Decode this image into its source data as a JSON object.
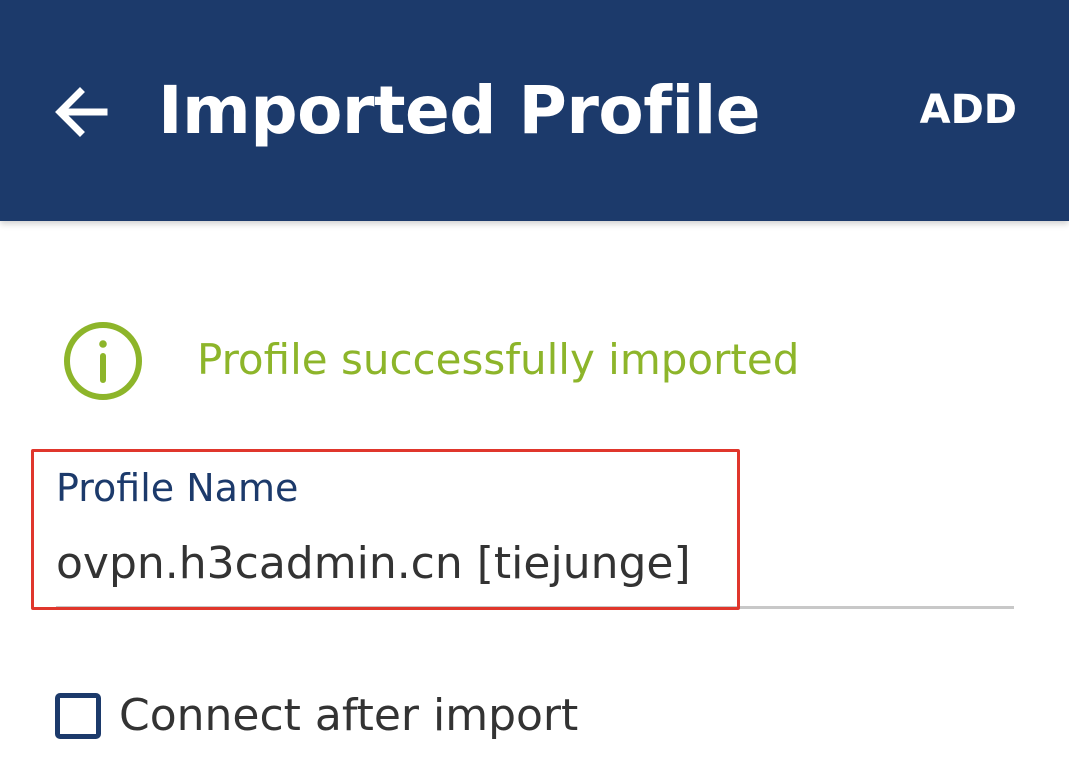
{
  "appbar": {
    "title": "Imported Profile",
    "action_label": "ADD",
    "back_icon": "arrow-left-icon",
    "background": "#1c3a6b"
  },
  "status": {
    "icon": "info-icon",
    "message": "Profile successfully imported",
    "color": "#8db52a"
  },
  "profile_name": {
    "label": "Profile Name",
    "value": "ovpn.h3cadmin.cn [tiejunge]"
  },
  "connect_option": {
    "label": "Connect after import",
    "checked": false
  },
  "colors": {
    "accent": "#1c3a6b",
    "highlight": "#e0362c",
    "success": "#8db52a"
  }
}
